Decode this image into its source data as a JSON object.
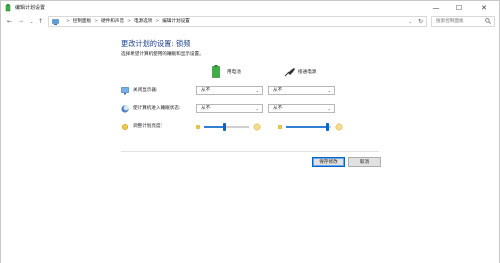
{
  "window": {
    "title": "编辑计划设置",
    "minimize_glyph": "—",
    "maximize_glyph": "☐",
    "close_glyph": "✕"
  },
  "nav": {
    "back_glyph": "←",
    "forward_glyph": "→",
    "recent_glyph": "⌄",
    "up_glyph": "↑",
    "dropdown_glyph": "⌄",
    "refresh_glyph": "↻"
  },
  "breadcrumb": {
    "separator": ">",
    "items": [
      "控制面板",
      "硬件和声音",
      "电源选项",
      "编辑计划设置"
    ]
  },
  "search": {
    "placeholder": "搜索控制面板"
  },
  "page": {
    "title": "更改计划的设置: 锁频",
    "subtitle": "选择希望计算机使用的睡眠和显示设置。"
  },
  "columns": {
    "battery": "用电池",
    "plugged": "接通电源"
  },
  "settings": {
    "display_off": {
      "label": "关闭显示器:",
      "battery": "从不",
      "plugged": "从不"
    },
    "sleep": {
      "label": "使计算机进入睡眠状态:",
      "battery": "从不",
      "plugged": "从不"
    },
    "brightness": {
      "label": "调整计划亮度:",
      "battery_level": 0.45,
      "plugged_level": 0.9
    }
  },
  "dropdown_arrow": "⌄",
  "buttons": {
    "save": "保存修改",
    "cancel": "取消"
  },
  "colors": {
    "title_blue": "#1e3f8a",
    "slider_blue": "#0b63c4",
    "battery_green": "#3cb043"
  },
  "icons": [
    "power-options-icon",
    "control-panel-icon",
    "search-icon",
    "battery-icon",
    "plug-icon",
    "monitor-icon",
    "sleep-moon-icon",
    "sun-small-icon",
    "sun-large-icon"
  ]
}
